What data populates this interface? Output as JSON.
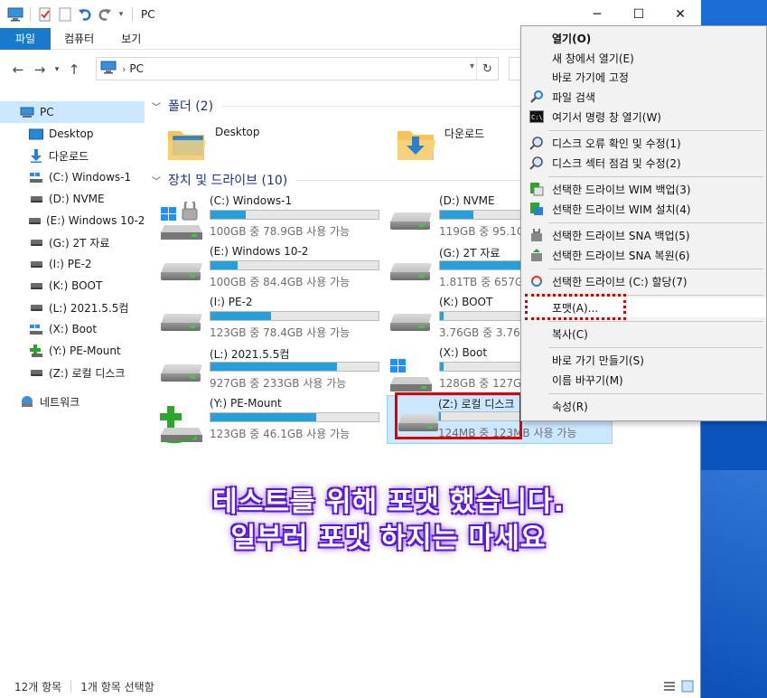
{
  "window": {
    "title": "PC",
    "controls": {
      "minimize": "─",
      "maximize": "☐",
      "close": "✕"
    }
  },
  "ribbon": {
    "tabs": [
      "파일",
      "컴퓨터",
      "보기"
    ]
  },
  "address": {
    "path": "PC",
    "separator": "›"
  },
  "sidebar": {
    "items": [
      {
        "label": "PC",
        "icon": "pc-icon"
      },
      {
        "label": "Desktop",
        "icon": "desktop-folder-icon"
      },
      {
        "label": "다운로드",
        "icon": "download-arrow-icon"
      },
      {
        "label": "(C:) Windows-1",
        "icon": "windows-drive-icon"
      },
      {
        "label": "(D:) NVME",
        "icon": "drive-icon"
      },
      {
        "label": "(E:) Windows 10-2",
        "icon": "drive-icon"
      },
      {
        "label": "(G:) 2T 자료",
        "icon": "drive-icon"
      },
      {
        "label": "(I:) PE-2",
        "icon": "drive-icon"
      },
      {
        "label": "(K:) BOOT",
        "icon": "drive-icon"
      },
      {
        "label": "(L:) 2021.5.5컴",
        "icon": "drive-icon"
      },
      {
        "label": "(X:) Boot",
        "icon": "windows-drive-icon"
      },
      {
        "label": "(Y:) PE-Mount",
        "icon": "mount-drive-icon"
      },
      {
        "label": "(Z:) 로컬 디스크",
        "icon": "drive-icon"
      },
      {
        "label": "네트워크",
        "icon": "network-icon"
      }
    ]
  },
  "folders": {
    "header": "폴더 (2)",
    "items": [
      {
        "name": "Desktop",
        "icon": "desktop-folder-icon"
      },
      {
        "name": "다운로드",
        "icon": "download-folder-icon"
      }
    ]
  },
  "drives": {
    "header": "장치 및 드라이브 (10)",
    "items": [
      {
        "name": "(C:) Windows-1",
        "free": "100GB 중 78.9GB 사용 가능",
        "used_fraction": 0.21,
        "icon": "windows-drive-icon"
      },
      {
        "name": "(D:) NVME",
        "free": "119GB 중 95.1G",
        "used_fraction": 0.2,
        "icon": "drive-icon"
      },
      {
        "name": "(E:) Windows 10-2",
        "free": "100GB 중 84.4GB 사용 가능",
        "used_fraction": 0.16,
        "icon": "drive-icon"
      },
      {
        "name": "(G:) 2T 자료",
        "free": "1.81TB 중 657GB",
        "used_fraction": 0.64,
        "icon": "drive-icon"
      },
      {
        "name": "(I:) PE-2",
        "free": "123GB 중 78.4GB 사용 가능",
        "used_fraction": 0.36,
        "icon": "drive-icon"
      },
      {
        "name": "(K:) BOOT",
        "free": "3.76GB 중 3.76G",
        "used_fraction": 0.02,
        "icon": "drive-icon"
      },
      {
        "name": "(L:) 2021.5.5컴",
        "free": "927GB 중 233GB 사용 가능",
        "used_fraction": 0.75,
        "icon": "drive-icon"
      },
      {
        "name": "(X:) Boot",
        "free": "128GB 중 127GB",
        "used_fraction": 0.02,
        "icon": "windows-drive-icon"
      },
      {
        "name": "(Y:) PE-Mount",
        "free": "123GB 중 46.1GB 사용 가능",
        "used_fraction": 0.63,
        "icon": "mount-drive-icon"
      },
      {
        "name": "(Z:) 로컬 디스크",
        "free": "124MB 중 123MB 사용 가능",
        "used_fraction": 0.01,
        "icon": "drive-icon"
      }
    ]
  },
  "context_menu": {
    "items": [
      {
        "label": "열기(O)",
        "icon": "",
        "bold": true
      },
      {
        "label": "새 창에서 열기(E)",
        "icon": ""
      },
      {
        "label": "바로 가기에 고정",
        "icon": ""
      },
      {
        "label": "파일 검색",
        "icon": "search-icon"
      },
      {
        "label": "여기서 명령 창 열기(W)",
        "icon": "cmd-icon"
      },
      {
        "label": "디스크 오류 확인 및 수정(1)",
        "icon": "disk-check-icon"
      },
      {
        "label": "디스크 섹터 점검 및 수정(2)",
        "icon": "disk-check-icon"
      },
      {
        "label": "선택한 드라이브 WIM 백업(3)",
        "icon": "wim-backup-icon"
      },
      {
        "label": "선택한 드라이브 WIM 설치(4)",
        "icon": "wim-install-icon"
      },
      {
        "label": "선택한 드라이브 SNA 백업(5)",
        "icon": "sna-backup-icon"
      },
      {
        "label": "선택한 드라이브 SNA 복원(6)",
        "icon": "sna-restore-icon"
      },
      {
        "label": "선택한 드라이브 (C:) 할당(7)",
        "icon": "assign-icon"
      },
      {
        "label": "포맷(A)...",
        "icon": ""
      },
      {
        "label": "복사(C)",
        "icon": ""
      },
      {
        "label": "바로 가기 만들기(S)",
        "icon": ""
      },
      {
        "label": "이름 바꾸기(M)",
        "icon": ""
      },
      {
        "label": "속성(R)",
        "icon": ""
      }
    ]
  },
  "caption": {
    "line1": "테스트를 위해 포맷 했습니다.",
    "line2": "일부러 포맷 하지는 마세요"
  },
  "status": {
    "count": "12개 항목",
    "selected": "1개 항목 선택함"
  },
  "colors": {
    "accent": "#1979ca",
    "bar": "#26a0da",
    "selection": "#cce8ff",
    "highlight_red": "#e10000",
    "caption_glow": "#5a17d6"
  }
}
